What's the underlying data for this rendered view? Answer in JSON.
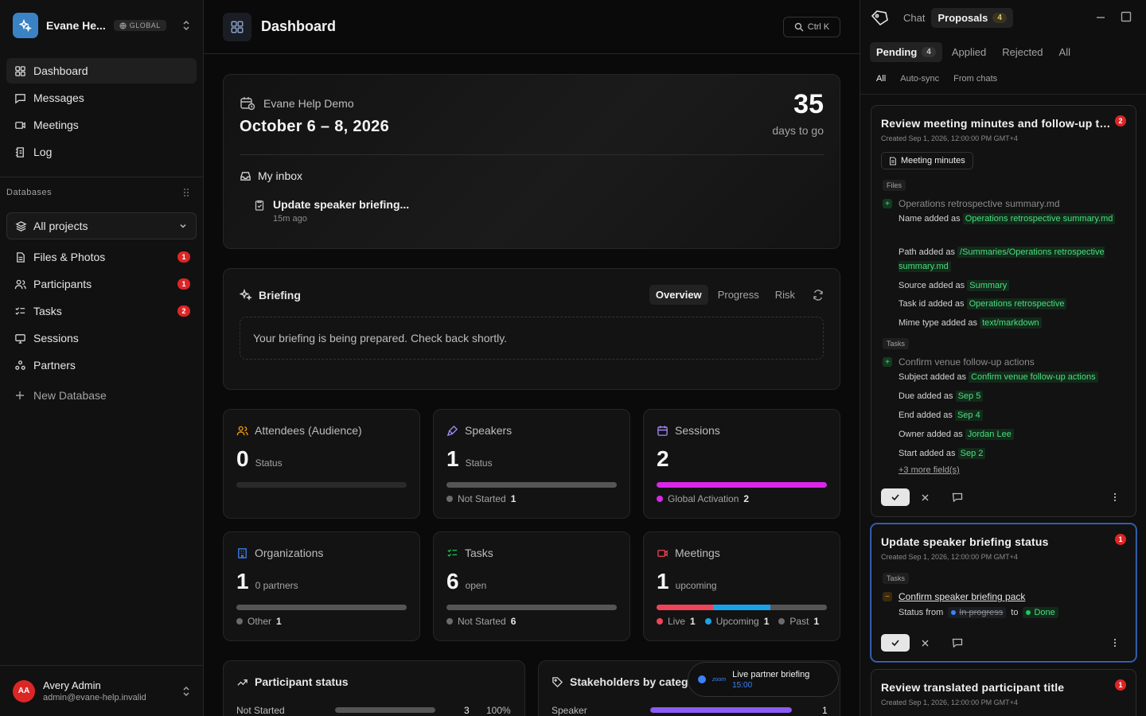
{
  "workspace": {
    "name": "Evane He...",
    "scope": "GLOBAL"
  },
  "nav": [
    {
      "label": "Dashboard",
      "icon": "dashboard-icon"
    },
    {
      "label": "Messages",
      "icon": "message-icon"
    },
    {
      "label": "Meetings",
      "icon": "video-icon"
    },
    {
      "label": "Log",
      "icon": "log-icon"
    }
  ],
  "databases": {
    "label": "Databases",
    "project_filter": "All projects",
    "items": [
      {
        "label": "Files & Photos",
        "count": "1"
      },
      {
        "label": "Participants",
        "count": "1"
      },
      {
        "label": "Tasks",
        "count": "2"
      },
      {
        "label": "Sessions",
        "count": ""
      },
      {
        "label": "Partners",
        "count": ""
      }
    ],
    "new_label": "New Database"
  },
  "user": {
    "initials": "AA",
    "name": "Avery Admin",
    "email": "admin@evane-help.invalid"
  },
  "header": {
    "title": "Dashboard",
    "shortcut": "Ctrl K"
  },
  "event": {
    "name": "Evane Help Demo",
    "dates": "October 6 – 8, 2026",
    "days": "35",
    "days_label": "days to go",
    "inbox_title": "My inbox",
    "inbox_item": "Update speaker briefing...",
    "inbox_time": "15m ago"
  },
  "briefing": {
    "title": "Briefing",
    "tabs": [
      "Overview",
      "Progress",
      "Risk"
    ],
    "message": "Your briefing is being prepared. Check back shortly."
  },
  "stats": [
    {
      "title": "Attendees (Audience)",
      "value": "0",
      "unit": "Status",
      "segments": [],
      "legend": []
    },
    {
      "title": "Speakers",
      "value": "1",
      "unit": "Status",
      "segments": [
        {
          "color": "#555555",
          "fraction": 1
        }
      ],
      "legend": [
        {
          "label": "Not Started",
          "count": "1",
          "color": "#6b6b6b"
        }
      ]
    },
    {
      "title": "Sessions",
      "value": "2",
      "unit": "",
      "segments": [
        {
          "color": "#d926e8",
          "fraction": 1
        }
      ],
      "legend": [
        {
          "label": "Global Activation",
          "count": "2",
          "color": "#d926e8"
        }
      ]
    },
    {
      "title": "Organizations",
      "value": "1",
      "unit": "0 partners",
      "segments": [
        {
          "color": "#555555",
          "fraction": 1
        }
      ],
      "legend": [
        {
          "label": "Other",
          "count": "1",
          "color": "#6b6b6b"
        }
      ]
    },
    {
      "title": "Tasks",
      "value": "6",
      "unit": "open",
      "segments": [
        {
          "color": "#555555",
          "fraction": 1
        }
      ],
      "legend": [
        {
          "label": "Not Started",
          "count": "6",
          "color": "#6b6b6b"
        }
      ]
    },
    {
      "title": "Meetings",
      "value": "1",
      "unit": "upcoming",
      "segments": [
        {
          "color": "#ef4458",
          "fraction": 0.333
        },
        {
          "color": "#1aa3e8",
          "fraction": 0.333
        },
        {
          "color": "#555555",
          "fraction": 0.334
        }
      ],
      "legend": [
        {
          "label": "Live",
          "count": "1",
          "color": "#ef4458"
        },
        {
          "label": "Upcoming",
          "count": "1",
          "color": "#1aa3e8"
        },
        {
          "label": "Past",
          "count": "1",
          "color": "#6b6b6b"
        }
      ]
    }
  ],
  "participant_status": {
    "title": "Participant status",
    "row_label": "Not Started",
    "row_value": "3",
    "row_pct": "100%",
    "fraction": 1
  },
  "stakeholders": {
    "title": "Stakeholders by categ",
    "row_label": "Speaker",
    "row_value": "1",
    "fraction": 1
  },
  "toast": {
    "title": "Live partner briefing",
    "time": "15:00",
    "brand": "zoom"
  },
  "panel": {
    "tabs": [
      "Chat",
      "Proposals"
    ],
    "proposals_count": "4",
    "status_tabs": [
      "Pending",
      "Applied",
      "Rejected",
      "All"
    ],
    "pending_count": "4",
    "sub_tabs": [
      "All",
      "Auto-sync",
      "From chats"
    ]
  },
  "proposals": [
    {
      "title": "Review meeting minutes and follow-up tasks",
      "count": "2",
      "meta": "Created Sep 1, 2026, 12:00:00 PM GMT+4",
      "chip": "Meeting minutes",
      "files_tag": "Files",
      "file_name": "Operations retrospective summary.md",
      "file_fields": [
        {
          "label": "Name added as",
          "value": "Operations retrospective summary.md"
        },
        {
          "label": "Path added as",
          "value": "/Summaries/Operations retrospective summary.md"
        },
        {
          "label": "Source added as",
          "value": "Summary"
        },
        {
          "label": "Task id added as",
          "value": "Operations retrospective"
        },
        {
          "label": "Mime type added as",
          "value": "text/markdown"
        }
      ],
      "tasks_tag": "Tasks",
      "task_name": "Confirm venue follow-up actions",
      "task_fields": [
        {
          "label": "Subject added as",
          "value": "Confirm venue follow-up actions"
        },
        {
          "label": "Due added as",
          "value": "Sep 5"
        },
        {
          "label": "End added as",
          "value": "Sep 4"
        },
        {
          "label": "Owner added as",
          "value": "Jordan Lee"
        },
        {
          "label": "Start added as",
          "value": "Sep 2"
        }
      ],
      "more": "+3 more field(s)"
    },
    {
      "title": "Update speaker briefing status",
      "count": "1",
      "meta": "Created Sep 1, 2026, 12:00:00 PM GMT+4",
      "tasks_tag": "Tasks",
      "change_label": "Confirm speaker briefing pack",
      "status_from_label": "Status from",
      "status_old": "In progress",
      "status_to_label": "to",
      "status_new": "Done"
    },
    {
      "title": "Review translated participant title",
      "count": "1",
      "meta": "Created Sep 1, 2026, 12:00:00 PM GMT+4"
    }
  ]
}
